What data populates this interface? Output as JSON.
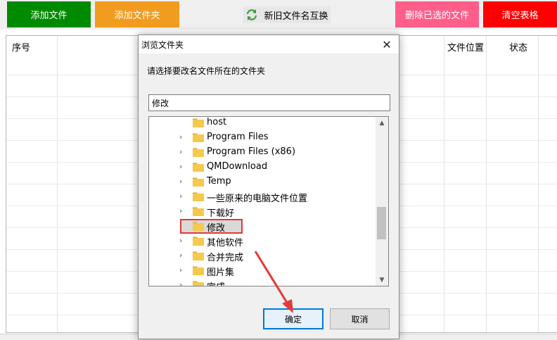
{
  "toolbar": {
    "add_file": "添加文件",
    "add_folder": "添加文件夹",
    "swap_names": "新旧文件名互换",
    "delete_selected": "删除已选的文件",
    "clear_table": "清空表格"
  },
  "table": {
    "columns": {
      "seq": "序号",
      "location": "文件位置",
      "status": "状态"
    }
  },
  "dialog": {
    "title": "浏览文件夹",
    "close_glyph": "✕",
    "prompt": "请选择要改名文件所在的文件夹",
    "path_value": "修改",
    "tree_items": [
      {
        "label": "host",
        "has_children": false
      },
      {
        "label": "Program Files",
        "has_children": true
      },
      {
        "label": "Program Files (x86)",
        "has_children": true
      },
      {
        "label": "QMDownload",
        "has_children": true
      },
      {
        "label": "Temp",
        "has_children": true
      },
      {
        "label": "一些原来的电脑文件位置",
        "has_children": true
      },
      {
        "label": "下载好",
        "has_children": true
      },
      {
        "label": "修改",
        "has_children": false,
        "selected": true
      },
      {
        "label": "其他软件",
        "has_children": true
      },
      {
        "label": "合并完成",
        "has_children": true
      },
      {
        "label": "图片集",
        "has_children": true
      },
      {
        "label": "完成",
        "has_children": true
      }
    ],
    "ok": "确定",
    "cancel": "取消"
  },
  "colors": {
    "add_file": "#008a00",
    "add_folder": "#f29c1f",
    "delete_selected": "#ff5e8a",
    "clear_table": "#ff0000",
    "highlight_box": "#e53935",
    "folder_icon": "#f5c94c"
  },
  "icons": {
    "swap": "refresh-arrows-icon",
    "folder": "folder-icon",
    "expand": "chevron-right-icon",
    "scroll_up": "chevron-up-icon",
    "scroll_down": "chevron-down-icon"
  }
}
